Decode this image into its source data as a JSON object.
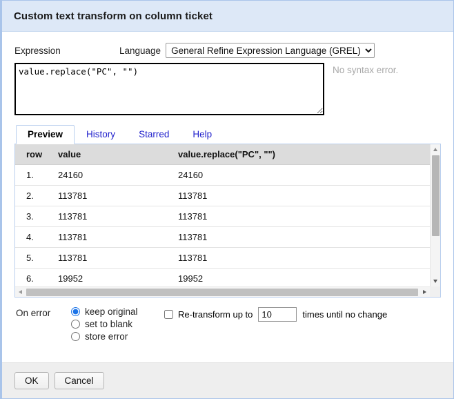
{
  "dialog": {
    "title": "Custom text transform on column ticket"
  },
  "expression": {
    "label": "Expression",
    "language_label": "Language",
    "language_selected": "General Refine Expression Language (GREL)",
    "language_options": [
      "General Refine Expression Language (GREL)"
    ],
    "value": "value.replace(\"PC\", \"\")",
    "placeholder": "",
    "syntax_status": "No syntax error."
  },
  "tabs": [
    {
      "label": "Preview",
      "active": true
    },
    {
      "label": "History",
      "active": false
    },
    {
      "label": "Starred",
      "active": false
    },
    {
      "label": "Help",
      "active": false
    }
  ],
  "preview": {
    "headers": [
      "row",
      "value",
      "value.replace(\"PC\", \"\")"
    ],
    "rows": [
      {
        "row": "1.",
        "value": "24160",
        "result": "24160"
      },
      {
        "row": "2.",
        "value": "113781",
        "result": "113781"
      },
      {
        "row": "3.",
        "value": "113781",
        "result": "113781"
      },
      {
        "row": "4.",
        "value": "113781",
        "result": "113781"
      },
      {
        "row": "5.",
        "value": "113781",
        "result": "113781"
      },
      {
        "row": "6.",
        "value": "19952",
        "result": "19952"
      }
    ]
  },
  "options": {
    "on_error_label": "On error",
    "radios": [
      {
        "label": "keep original",
        "checked": true
      },
      {
        "label": "set to blank",
        "checked": false
      },
      {
        "label": "store error",
        "checked": false
      }
    ],
    "retransform": {
      "checked": false,
      "prefix": "Re-transform up to",
      "count": "10",
      "suffix": "times until no change"
    }
  },
  "footer": {
    "ok_label": "OK",
    "cancel_label": "Cancel"
  },
  "colors": {
    "titlebar": "#dde8f7",
    "dialog_border": "#a9c4ea",
    "accent": "#1a73e8",
    "tab_link": "#2222cc",
    "header_row": "#dcdcdc",
    "muted_text": "#a8a8a8"
  }
}
